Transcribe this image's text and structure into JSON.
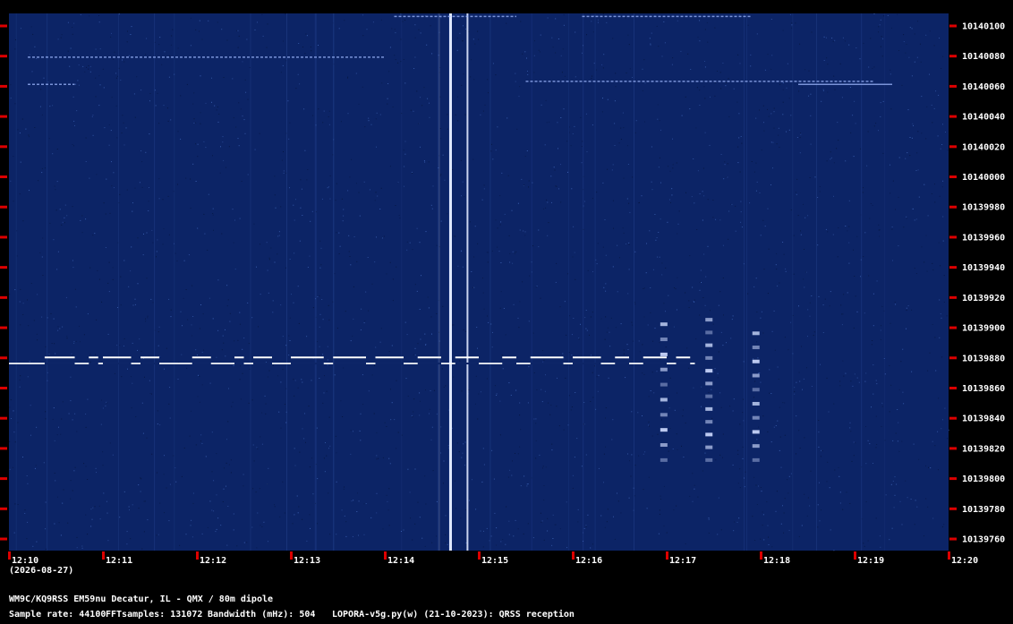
{
  "chart_data": {
    "type": "heatmap",
    "subtype": "spectrogram",
    "colors": {
      "background": "#000000",
      "field": "#0c2466",
      "signal": "#ffffff",
      "tick": "#dd0000",
      "text": "#ffffff"
    },
    "y_ticks": [
      "10140100",
      "10140080",
      "10140060",
      "10140040",
      "10140020",
      "10140000",
      "10139980",
      "10139960",
      "10139940",
      "10139920",
      "10139900",
      "10139880",
      "10139860",
      "10139840",
      "10139820",
      "10139800",
      "10139780",
      "10139760"
    ],
    "y_values": [
      10140100,
      10140080,
      10140060,
      10140040,
      10140020,
      10140000,
      10139980,
      10139960,
      10139940,
      10139920,
      10139900,
      10139880,
      10139860,
      10139840,
      10139820,
      10139800,
      10139780,
      10139760
    ],
    "ylim": [
      10139752,
      10140108
    ],
    "x_ticks": [
      "12:10",
      "12:11",
      "12:12",
      "12:13",
      "12:14",
      "12:15",
      "12:16",
      "12:17",
      "12:18",
      "12:19",
      "12:20"
    ],
    "x_minutes": [
      0,
      1,
      2,
      3,
      4,
      5,
      6,
      7,
      8,
      9,
      10
    ],
    "xlim_minutes": [
      0,
      10
    ],
    "main_signal": {
      "base_hz": 10139876,
      "high_hz": 10139880,
      "end_min": 7.3,
      "segments": [
        [
          0.38,
          0.7
        ],
        [
          0.85,
          0.95
        ],
        [
          1.0,
          1.3
        ],
        [
          1.4,
          1.6
        ],
        [
          1.95,
          2.15
        ],
        [
          2.4,
          2.5
        ],
        [
          2.6,
          2.8
        ],
        [
          3.0,
          3.35
        ],
        [
          3.45,
          3.8
        ],
        [
          3.9,
          4.2
        ],
        [
          4.35,
          4.6
        ],
        [
          4.75,
          5.0
        ],
        [
          5.25,
          5.4
        ],
        [
          5.55,
          5.9
        ],
        [
          6.0,
          6.3
        ],
        [
          6.45,
          6.6
        ],
        [
          6.75,
          7.0
        ],
        [
          7.1,
          7.25
        ]
      ]
    },
    "carriers": [
      {
        "hz": 10140063,
        "start_min": 5.5,
        "end_min": 9.2,
        "dotted": true
      },
      {
        "hz": 10140061,
        "start_min": 8.4,
        "end_min": 9.4,
        "dotted": false
      },
      {
        "hz": 10140079,
        "start_min": 0.2,
        "end_min": 4.0,
        "dotted": true
      },
      {
        "hz": 10140061,
        "start_min": 0.2,
        "end_min": 0.7,
        "dotted": true
      },
      {
        "hz": 10140106,
        "start_min": 6.1,
        "end_min": 7.9,
        "dotted": true
      },
      {
        "hz": 10140106,
        "start_min": 4.1,
        "end_min": 5.4,
        "dotted": true
      }
    ],
    "vertical_lines": [
      {
        "min": 4.7,
        "intensity": 1.0,
        "width": 3
      },
      {
        "min": 4.88,
        "intensity": 0.9,
        "width": 2
      },
      {
        "min": 4.58,
        "intensity": 0.25,
        "width": 1
      }
    ],
    "dot_columns": [
      {
        "min": 6.97,
        "from_hz": 10139812,
        "to_hz": 10139902,
        "rows": 10
      },
      {
        "min": 7.45,
        "from_hz": 10139812,
        "to_hz": 10139905,
        "rows": 12
      },
      {
        "min": 7.95,
        "from_hz": 10139812,
        "to_hz": 10139896,
        "rows": 10
      }
    ],
    "xlabel": "",
    "ylabel": ""
  },
  "date_label": "(2026-08-27)",
  "station": "WM9C/KQ9RSS EM59nu Decatur, IL - QMX / 80m dipole",
  "sample_rate": "Sample rate: 44100",
  "fft_samples": "FFTsamples: 131072",
  "bandwidth": "Bandwidth (mHz): 504",
  "software": "LOPORA-v5g.py(w) (21-10-2023): QRSS reception"
}
